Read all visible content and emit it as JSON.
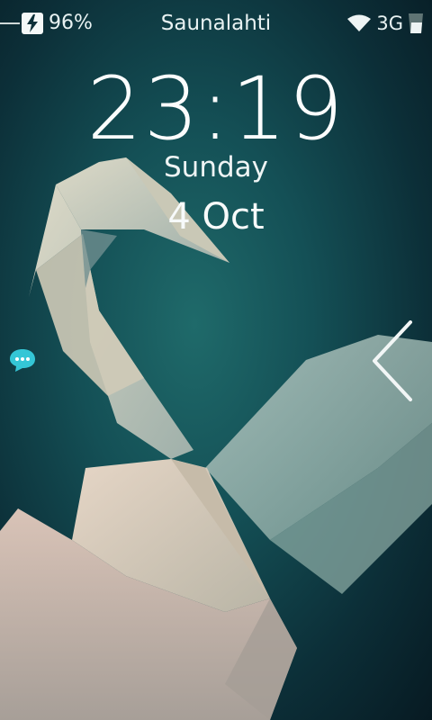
{
  "status_bar": {
    "battery_percent": "96%",
    "carrier": "Saunalahti",
    "network_type": "3G",
    "icons": [
      "usb-cable-icon",
      "charging-bolt-icon",
      "wifi-icon",
      "signal-strength-icon"
    ]
  },
  "lockscreen": {
    "time": "23:19",
    "day": "Sunday",
    "date": "4 Oct"
  },
  "side_indicators": {
    "left_icon": "message-notification-icon",
    "right_icon": "chevron-left-icon"
  },
  "colors": {
    "background_center": "#1f6a6a",
    "background_edge": "#071a22",
    "message_icon": "#34c6d6"
  }
}
